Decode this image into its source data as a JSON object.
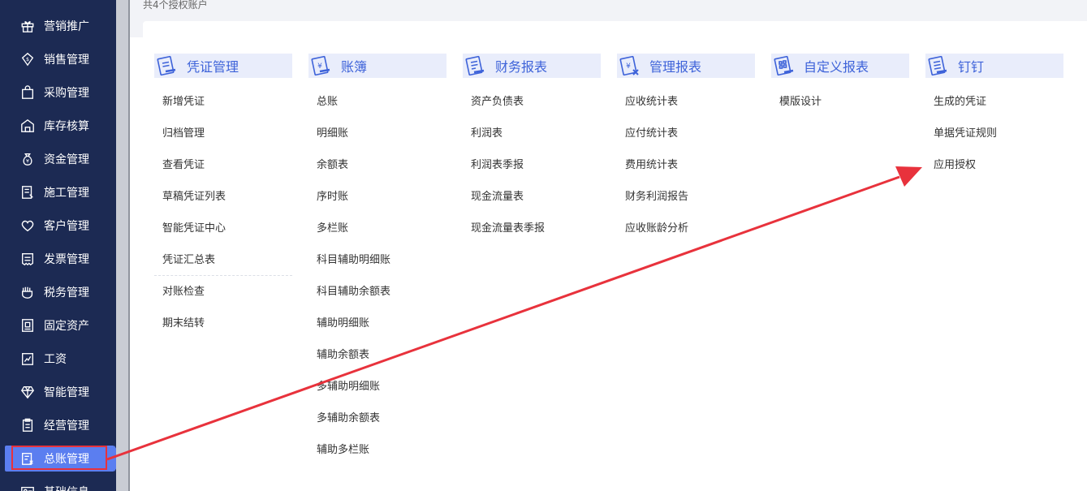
{
  "topbar": {
    "count_text": "共4个授权账户"
  },
  "sidebar": {
    "items": [
      {
        "label": "营销推广",
        "icon": "gift-icon"
      },
      {
        "label": "销售管理",
        "icon": "sales-icon"
      },
      {
        "label": "采购管理",
        "icon": "shopping-bag-icon"
      },
      {
        "label": "库存核算",
        "icon": "warehouse-icon"
      },
      {
        "label": "资金管理",
        "icon": "money-bag-icon"
      },
      {
        "label": "施工管理",
        "icon": "construction-icon"
      },
      {
        "label": "客户管理",
        "icon": "heart-icon"
      },
      {
        "label": "发票管理",
        "icon": "invoice-icon"
      },
      {
        "label": "税务管理",
        "icon": "tax-hand-icon"
      },
      {
        "label": "固定资产",
        "icon": "asset-icon"
      },
      {
        "label": "工资",
        "icon": "salary-icon"
      },
      {
        "label": "智能管理",
        "icon": "diamond-icon"
      },
      {
        "label": "经营管理",
        "icon": "clipboard-icon"
      },
      {
        "label": "总账管理",
        "icon": "ledger-icon"
      },
      {
        "label": "基础信息",
        "icon": "info-card-icon"
      }
    ],
    "active_index": 13
  },
  "menu": {
    "columns": [
      {
        "title": "凭证管理",
        "icon": "voucher-icon",
        "items": [
          "新增凭证",
          "归档管理",
          "查看凭证",
          "草稿凭证列表",
          "智能凭证中心",
          "凭证汇总表",
          "对账检查",
          "期末结转"
        ]
      },
      {
        "title": "账簿",
        "icon": "ledger-book-icon",
        "items": [
          "总账",
          "明细账",
          "余额表",
          "序时账",
          "多栏账",
          "科目辅助明细账",
          "科目辅助余额表",
          "辅助明细账",
          "辅助余额表",
          "多辅助明细账",
          "多辅助余额表",
          "辅助多栏账"
        ]
      },
      {
        "title": "财务报表",
        "icon": "financial-report-icon",
        "items": [
          "资产负债表",
          "利润表",
          "利润表季报",
          "现金流量表",
          "现金流量表季报"
        ]
      },
      {
        "title": "管理报表",
        "icon": "management-report-icon",
        "items": [
          "应收统计表",
          "应付统计表",
          "费用统计表",
          "财务利润报告",
          "应收账龄分析"
        ]
      },
      {
        "title": "自定义报表",
        "icon": "custom-report-icon",
        "items": [
          "模版设计"
        ]
      },
      {
        "title": "钉钉",
        "icon": "dingtalk-icon",
        "items": [
          "生成的凭证",
          "单据凭证规则",
          "应用授权"
        ]
      }
    ]
  },
  "colors": {
    "sidebar_bg": "#1c2a53",
    "active_bg": "#5b7ef0",
    "header_bg": "#e9edfb",
    "header_text": "#3d62d9",
    "arrow": "#e8323c"
  }
}
